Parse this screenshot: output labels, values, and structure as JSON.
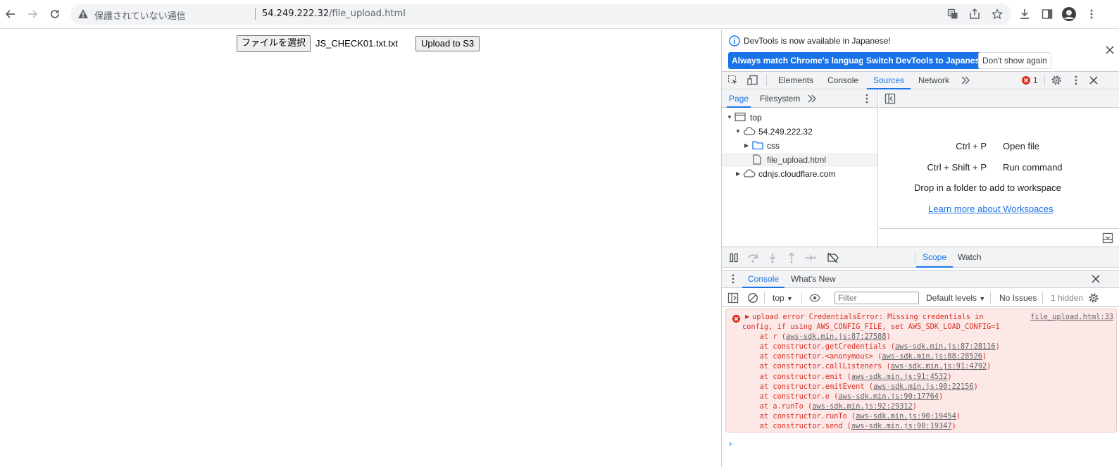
{
  "browser": {
    "security_text": "保護されていない通信",
    "url_host": "54.249.222.32",
    "url_path": "/file_upload.html"
  },
  "page": {
    "choose_file_label": "ファイルを選択",
    "file_name": "JS_CHECK01.txt.txt",
    "upload_label": "Upload to S3"
  },
  "devtools": {
    "infobar": {
      "message": "DevTools is now available in Japanese!",
      "btn_match": "Always match Chrome's language",
      "btn_switch": "Switch DevTools to Japanese",
      "btn_dismiss": "Don't show again"
    },
    "tabs": [
      "Elements",
      "Console",
      "Sources",
      "Network"
    ],
    "active_tab": "Sources",
    "error_count": "1",
    "navigator": {
      "tabs": [
        "Page",
        "Filesystem"
      ],
      "tree": [
        "top",
        "54.249.222.32",
        "css",
        "file_upload.html",
        "cdnjs.cloudflare.com"
      ]
    },
    "editor": {
      "shortcuts": [
        {
          "key": "Ctrl + P",
          "action": "Open file"
        },
        {
          "key": "Ctrl + Shift + P",
          "action": "Run command"
        }
      ],
      "drop_hint": "Drop in a folder to add to workspace",
      "learn_more": "Learn more about Workspaces"
    },
    "sidebar_tabs": [
      "Scope",
      "Watch"
    ],
    "drawer_tabs": [
      "Console",
      "What's New"
    ],
    "console_toolbar": {
      "context": "top",
      "filter_placeholder": "Filter",
      "levels": "Default levels",
      "issues": "No Issues",
      "hidden": "1 hidden"
    },
    "error": {
      "source_link": "file_upload.html:33",
      "line1": "upload error CredentialsError: Missing credentials in",
      "line2": "config, if using AWS_CONFIG_FILE, set AWS_SDK_LOAD_CONFIG=1",
      "stack": [
        {
          "fn": "r",
          "loc": "aws-sdk.min.js:87:27588"
        },
        {
          "fn": "constructor.getCredentials",
          "loc": "aws-sdk.min.js:87:28116"
        },
        {
          "fn": "constructor.<anonymous>",
          "loc": "aws-sdk.min.js:88:28526"
        },
        {
          "fn": "constructor.callListeners",
          "loc": "aws-sdk.min.js:91:4792"
        },
        {
          "fn": "constructor.emit",
          "loc": "aws-sdk.min.js:91:4532"
        },
        {
          "fn": "constructor.emitEvent",
          "loc": "aws-sdk.min.js:90:22156"
        },
        {
          "fn": "constructor.e",
          "loc": "aws-sdk.min.js:90:17764"
        },
        {
          "fn": "a.runTo",
          "loc": "aws-sdk.min.js:92:29312"
        },
        {
          "fn": "constructor.runTo",
          "loc": "aws-sdk.min.js:90:19454"
        },
        {
          "fn": "constructor.send",
          "loc": "aws-sdk.min.js:90:19347"
        }
      ]
    }
  }
}
